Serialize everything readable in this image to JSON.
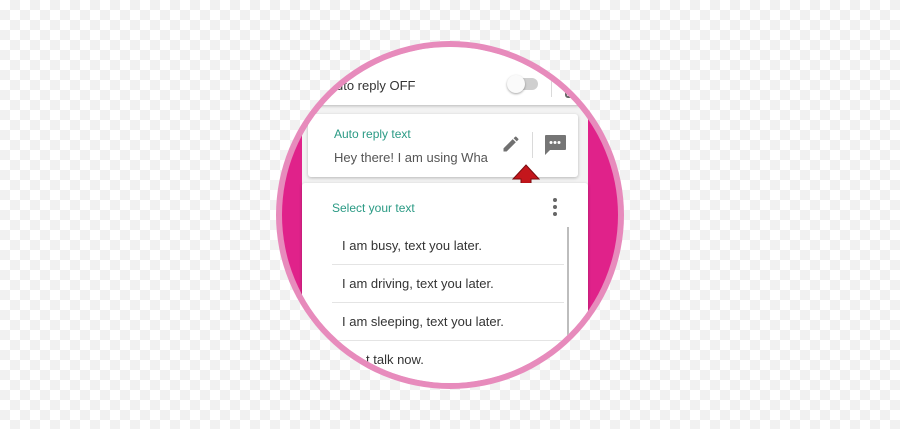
{
  "auto_reply": {
    "toggle_label": "uto reply OFF",
    "toggle_state": "off"
  },
  "reply_text": {
    "title": "Auto reply text",
    "value": "Hey there! I am using Wha..."
  },
  "select_text": {
    "title": "Select your text",
    "items": [
      "I am busy, text you later.",
      "I am driving, text you later.",
      "I am sleeping, text you later.",
      "t talk now."
    ]
  },
  "colors": {
    "accent": "#2a9a84",
    "circle_bg": "#e0228a",
    "ring": "#e78bbc",
    "arrow": "#c4161c"
  },
  "icons": [
    "phone-icon",
    "pencil-icon",
    "message-icon",
    "arrow-up-icon",
    "more-vert-icon"
  ]
}
